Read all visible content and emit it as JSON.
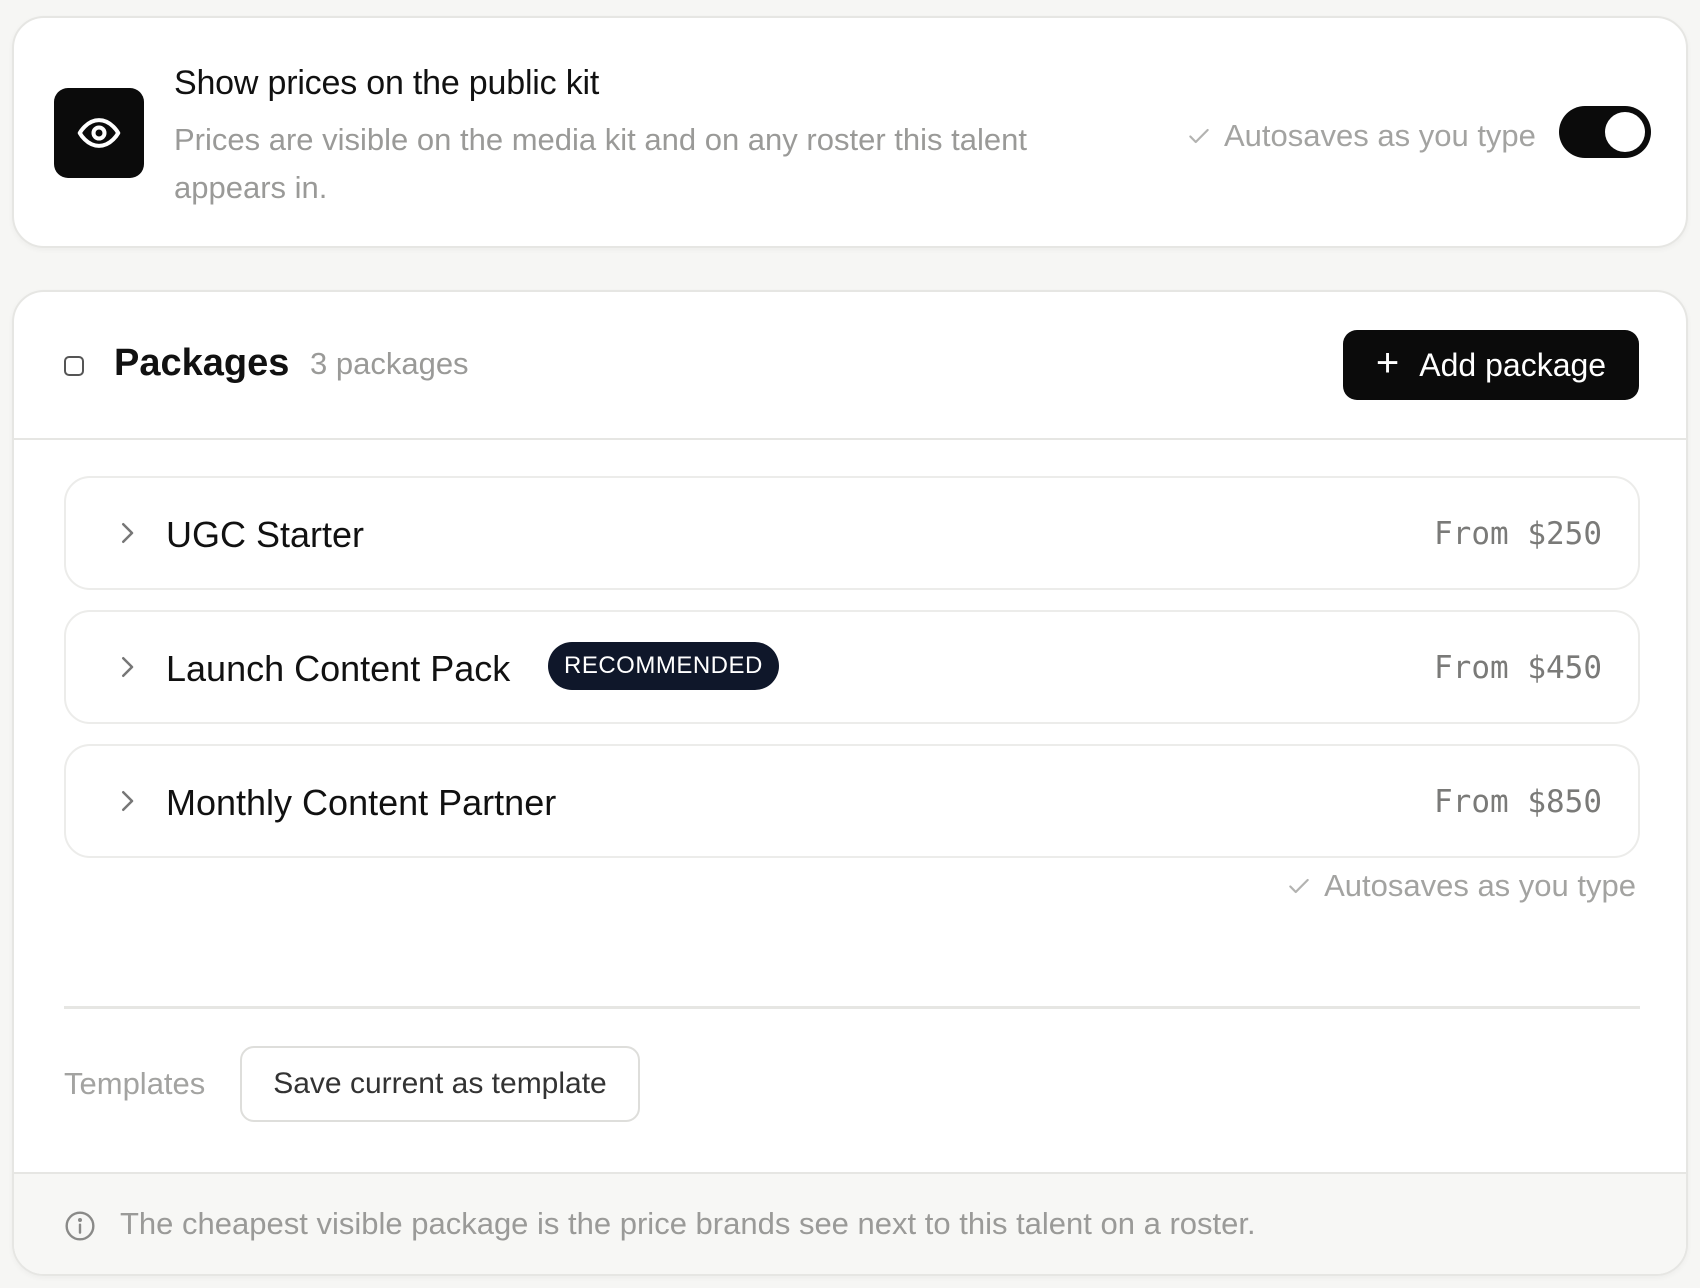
{
  "visibility": {
    "title": "Show prices on the public kit",
    "description": "Prices are visible on the media kit and on any roster this talent appears in.",
    "autosave_text": "Autosaves as you type",
    "toggle_on": true,
    "icon": "eye-icon"
  },
  "packages": {
    "title": "Packages",
    "count_text": "3 packages",
    "add_button_label": "Add package",
    "items": [
      {
        "name": "UGC Starter",
        "price": "From $250",
        "badge": ""
      },
      {
        "name": "Launch Content Pack",
        "price": "From $450",
        "badge": "RECOMMENDED"
      },
      {
        "name": "Monthly Content Partner",
        "price": "From $850",
        "badge": ""
      }
    ],
    "autosave_text": "Autosaves as you type",
    "templates_label": "Templates",
    "save_template_label": "Save current as template",
    "footer_note": "The cheapest visible package is the price brands see next to this talent on a roster."
  },
  "colors": {
    "accent": "#0b0b0b",
    "badge_bg": "#0f172a",
    "muted_text": "#9a9a98"
  }
}
